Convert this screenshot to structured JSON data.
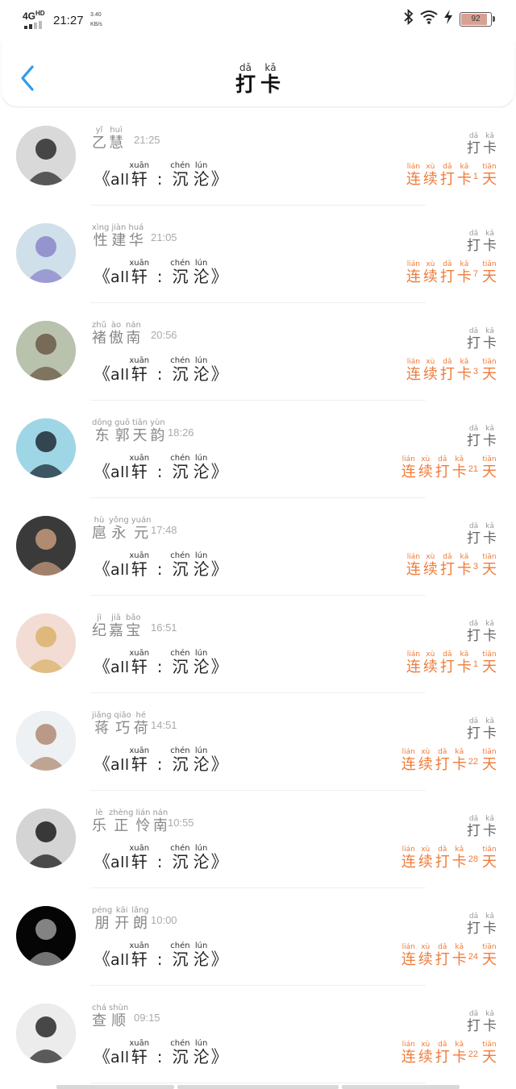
{
  "status_bar": {
    "network": "4G",
    "network_sup": "HD",
    "time": "21:27",
    "speed_value": "3.40",
    "speed_unit": "KB/s",
    "battery": "92",
    "battery_level": 0.92,
    "icons": [
      "signal-icon",
      "bluetooth-icon",
      "wifi-icon",
      "charging-icon",
      "battery-icon"
    ]
  },
  "header": {
    "back_icon": "chevron-left-icon",
    "title": [
      {
        "char": "打",
        "pinyin": "dǎ"
      },
      {
        "char": "卡",
        "pinyin": "kǎ"
      }
    ]
  },
  "checkin_label": [
    {
      "char": "打",
      "pinyin": "dǎ"
    },
    {
      "char": "卡",
      "pinyin": "kǎ"
    }
  ],
  "streak_prefix": [
    {
      "char": "连",
      "pinyin": "lián"
    },
    {
      "char": "续",
      "pinyin": "xù"
    },
    {
      "char": "打",
      "pinyin": "dǎ"
    },
    {
      "char": "卡",
      "pinyin": "kǎ"
    }
  ],
  "streak_suffix": {
    "char": "天",
    "pinyin": "tiān"
  },
  "group": {
    "open_quote": "《",
    "close_quote": "》",
    "latin": "all",
    "xuan": {
      "char": "轩",
      "pinyin": "xuān"
    },
    "colon": ":",
    "chen": {
      "char": "沉",
      "pinyin": "chén"
    },
    "lun": {
      "char": "沦",
      "pinyin": "lún"
    }
  },
  "records": [
    {
      "name": [
        {
          "char": "乙",
          "pinyin": "yǐ"
        },
        {
          "char": "慧",
          "pinyin": "huì"
        }
      ],
      "time": "21:25",
      "days": "1",
      "avatar": {
        "bg": "#d9d9d9",
        "fg": "#2b2b2b"
      }
    },
    {
      "name": [
        {
          "char": "性",
          "pinyin": "xìng"
        },
        {
          "char": "建",
          "pinyin": "jiàn"
        },
        {
          "char": "华",
          "pinyin": "huá"
        }
      ],
      "time": "21:05",
      "days": "7",
      "avatar": {
        "bg": "#cfe0ea",
        "fg": "#8a86c9"
      }
    },
    {
      "name": [
        {
          "char": "褚",
          "pinyin": "zhǔ"
        },
        {
          "char": "傲",
          "pinyin": "ào"
        },
        {
          "char": "南",
          "pinyin": "nán"
        }
      ],
      "time": "20:56",
      "days": "3",
      "avatar": {
        "bg": "#b9c2ad",
        "fg": "#6b5a46"
      }
    },
    {
      "name": [
        {
          "char": "东",
          "pinyin": "dōng"
        },
        {
          "char": "郭",
          "pinyin": "guō"
        },
        {
          "char": "天",
          "pinyin": "tiān"
        },
        {
          "char": "韵",
          "pinyin": "yùn"
        }
      ],
      "time": "18:26",
      "days": "21",
      "avatar": {
        "bg": "#9fd6e6",
        "fg": "#1e2b35"
      }
    },
    {
      "name": [
        {
          "char": "扈",
          "pinyin": "hù"
        },
        {
          "char": "永",
          "pinyin": "yǒng"
        },
        {
          "char": "元",
          "pinyin": "yuán"
        }
      ],
      "time": "17:48",
      "days": "3",
      "avatar": {
        "bg": "#3a3a3a",
        "fg": "#c49a7c"
      }
    },
    {
      "name": [
        {
          "char": "纪",
          "pinyin": "jì"
        },
        {
          "char": "嘉",
          "pinyin": "jiā"
        },
        {
          "char": "宝",
          "pinyin": "bǎo"
        }
      ],
      "time": "16:51",
      "days": "1",
      "avatar": {
        "bg": "#f3dcd3",
        "fg": "#d9b36b"
      }
    },
    {
      "name": [
        {
          "char": "蒋",
          "pinyin": "jiǎng"
        },
        {
          "char": "巧",
          "pinyin": "qiǎo"
        },
        {
          "char": "荷",
          "pinyin": "hé"
        }
      ],
      "time": "14:51",
      "days": "22",
      "avatar": {
        "bg": "#eef1f3",
        "fg": "#b08a73"
      }
    },
    {
      "name": [
        {
          "char": "乐",
          "pinyin": "lè"
        },
        {
          "char": "正",
          "pinyin": "zhèng"
        },
        {
          "char": "怜",
          "pinyin": "lián"
        },
        {
          "char": "南",
          "pinyin": "nán"
        }
      ],
      "time": "10:55",
      "days": "28",
      "avatar": {
        "bg": "#d4d4d4",
        "fg": "#1c1c1c"
      }
    },
    {
      "name": [
        {
          "char": "朋",
          "pinyin": "péng"
        },
        {
          "char": "开",
          "pinyin": "kāi"
        },
        {
          "char": "朗",
          "pinyin": "lǎng"
        }
      ],
      "time": "10:00",
      "days": "24",
      "avatar": {
        "bg": "#050505",
        "fg": "#9a9a9a"
      }
    },
    {
      "name": [
        {
          "char": "查",
          "pinyin": "chá"
        },
        {
          "char": "顺",
          "pinyin": "shùn"
        }
      ],
      "time": "09:15",
      "days": "22",
      "avatar": {
        "bg": "#ececec",
        "fg": "#2a2a2a"
      }
    }
  ]
}
